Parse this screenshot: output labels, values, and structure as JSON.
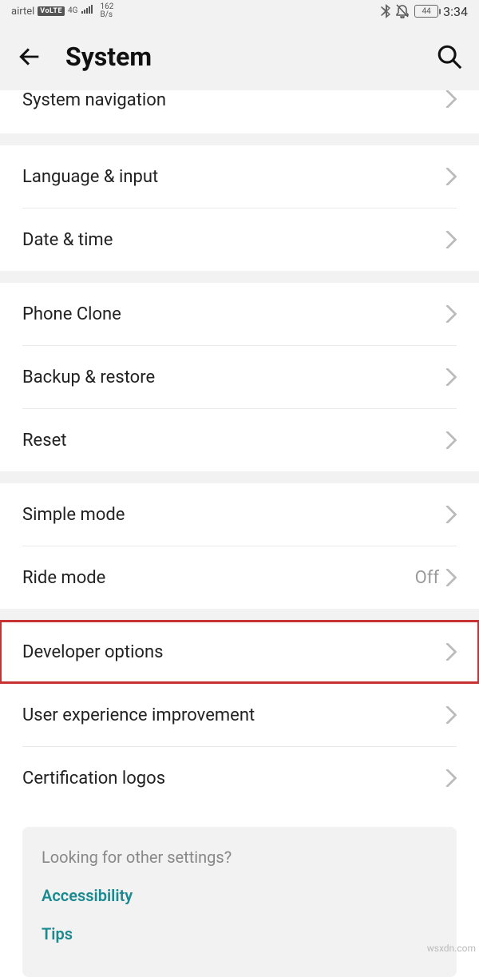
{
  "status": {
    "carrier": "airtel",
    "volte": "VoLTE",
    "net_label": "4G",
    "rate_top": "162",
    "rate_bottom": "B/s",
    "battery": "44",
    "time": "3:34"
  },
  "header": {
    "title": "System"
  },
  "sections": {
    "nav": {
      "system_navigation": "System navigation"
    },
    "lang": {
      "language_input": "Language & input",
      "date_time": "Date & time"
    },
    "clone": {
      "phone_clone": "Phone Clone",
      "backup_restore": "Backup & restore",
      "reset": "Reset"
    },
    "modes": {
      "simple_mode": "Simple mode",
      "ride_mode": "Ride mode",
      "ride_mode_value": "Off"
    },
    "dev": {
      "developer_options": "Developer options",
      "ux_improve": "User experience improvement",
      "cert_logos": "Certification logos"
    }
  },
  "tips": {
    "question": "Looking for other settings?",
    "accessibility": "Accessibility",
    "tips": "Tips"
  },
  "watermark": "wsxdn.com"
}
